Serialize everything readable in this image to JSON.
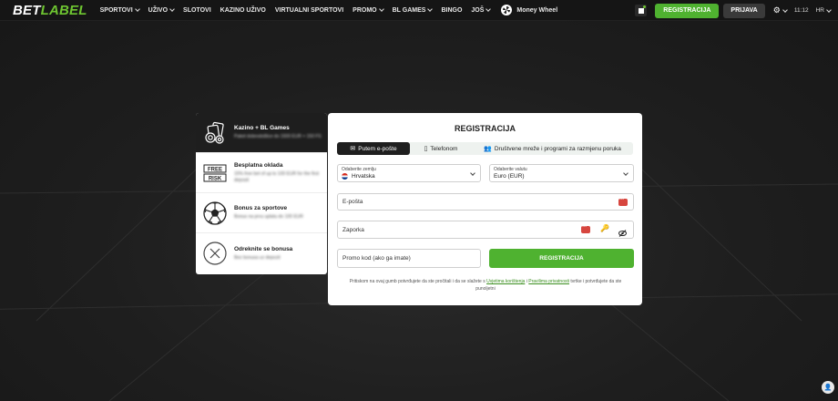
{
  "brand": {
    "logo_white": "BET",
    "logo_green": "LABEL"
  },
  "nav": {
    "items": [
      {
        "label": "SPORTOVI",
        "dropdown": true
      },
      {
        "label": "UŽIVO",
        "dropdown": true
      },
      {
        "label": "SLOTOVI",
        "dropdown": false
      },
      {
        "label": "KAZINO UŽIVO",
        "dropdown": false
      },
      {
        "label": "VIRTUALNI SPORTOVI",
        "dropdown": false
      },
      {
        "label": "PROMO",
        "dropdown": true
      },
      {
        "label": "BL GAMES",
        "dropdown": true
      },
      {
        "label": "BINGO",
        "dropdown": false
      },
      {
        "label": "JOŠ",
        "dropdown": true
      }
    ],
    "money_wheel": "Money Wheel"
  },
  "header": {
    "register_label": "REGISTRACIJA",
    "login_label": "PRIJAVA",
    "time": "11:12",
    "language": "HR"
  },
  "promos": [
    {
      "title": "Kazino + BL Games",
      "subtitle": "Paket dobrodošlice do 1500 EUR + 150 FS",
      "icon": "casino-chips-icon",
      "active": true
    },
    {
      "title": "Besplatna oklada",
      "subtitle": "15% free bet of up to 100 EUR for the first deposit",
      "icon": "free-risk-icon",
      "active": false
    },
    {
      "title": "Bonus za sportove",
      "subtitle": "Bonus na prvu uplatu do 100 EUR",
      "icon": "football-icon",
      "active": false
    },
    {
      "title": "Odreknite se bonusa",
      "subtitle": "Bez bonusa uz depozit",
      "icon": "decline-x-icon",
      "active": false
    }
  ],
  "form": {
    "title": "REGISTRACIJA",
    "tabs": [
      {
        "label": "Putem e-pošte",
        "icon": "envelope-icon",
        "active": true
      },
      {
        "label": "Telefonom",
        "icon": "phone-icon",
        "active": false
      },
      {
        "label": "Društvene mreže i programi za razmjenu poruka",
        "icon": "people-icon",
        "active": false
      }
    ],
    "country": {
      "label": "Odaberite zemlju",
      "value": "Hrvatska"
    },
    "currency": {
      "label": "Odaberite valutu",
      "value": "Euro (EUR)"
    },
    "email": {
      "placeholder": "E-pošta"
    },
    "password": {
      "placeholder": "Zaporka"
    },
    "promo": {
      "placeholder": "Promo kod (ako ga imate)"
    },
    "submit_label": "REGISTRACIJA",
    "terms": {
      "before": "Pritiskom na ovaj gumb potvrđujete da ste pročitali i da se slažete s",
      "link1": "Uvjetima korištenja",
      "middle": "i",
      "link2": "Pravilima privatnosti",
      "after": "tvrtke i potvrđujete da ste punoljetni"
    }
  },
  "colors": {
    "accent": "#4fb230",
    "dark": "#1f1f1f",
    "danger": "#d7463f"
  }
}
